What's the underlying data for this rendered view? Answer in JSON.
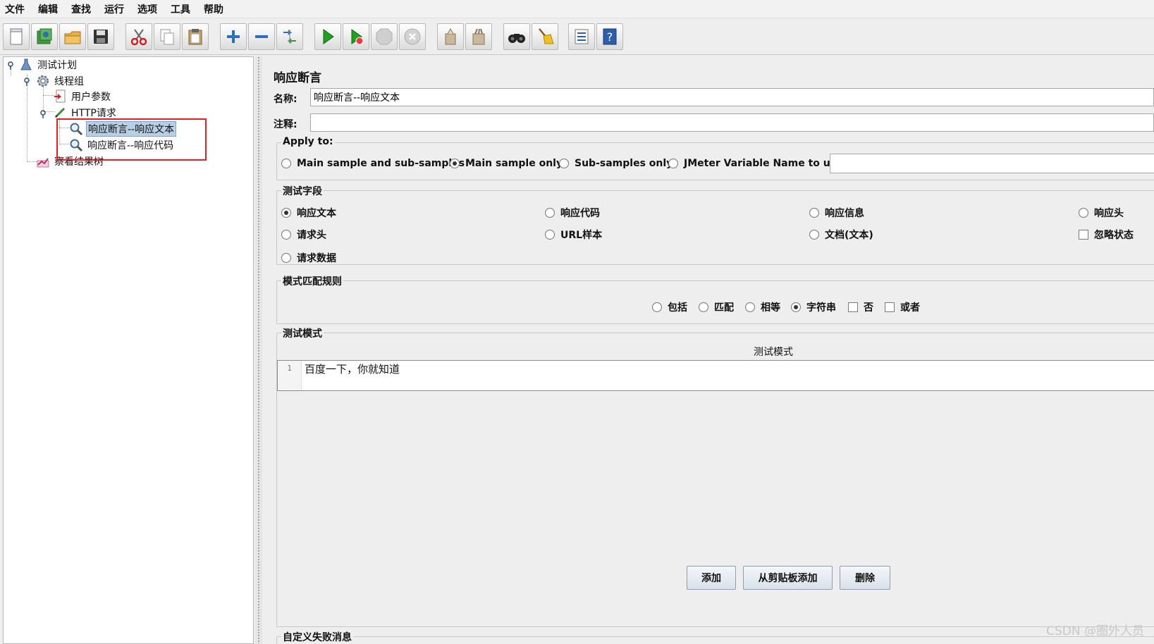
{
  "menu": [
    "文件",
    "编辑",
    "查找",
    "运行",
    "选项",
    "工具",
    "帮助"
  ],
  "toolbar_icons": [
    "new-icon",
    "templates-icon",
    "open-icon",
    "save-icon",
    "cut-icon",
    "copy-icon",
    "paste-icon",
    "expand-icon",
    "collapse-icon",
    "toggle-icon",
    "start-icon",
    "start-no-pause-icon",
    "stop-icon",
    "shutdown-icon",
    "clear-icon",
    "clear-all-icon",
    "search-icon",
    "reset-search-icon",
    "function-helper-icon",
    "help-icon"
  ],
  "tree": {
    "test_plan": "测试计划",
    "thread_group": "线程组",
    "user_params": "用户参数",
    "http_request": "HTTP请求",
    "assertion_text": "响应断言--响应文本",
    "assertion_code": "响应断言--响应代码",
    "result_tree": "察看结果树"
  },
  "panel": {
    "title": "响应断言",
    "name_label": "名称:",
    "name_value": "响应断言--响应文本",
    "comment_label": "注释:",
    "comment_value": ""
  },
  "apply_to": {
    "title": "Apply to:",
    "options": [
      "Main sample and sub-samples",
      "Main sample only",
      "Sub-samples only",
      "JMeter Variable Name to use"
    ],
    "selected": "Main sample only",
    "variable_value": ""
  },
  "test_field": {
    "title": "测试字段",
    "options": [
      "响应文本",
      "响应代码",
      "响应信息",
      "响应头",
      "请求头",
      "URL样本",
      "文档(文本)",
      "忽略状态",
      "请求数据"
    ],
    "selected": "响应文本"
  },
  "pattern_rules": {
    "title": "模式匹配规则",
    "options": [
      "包括",
      "匹配",
      "相等",
      "字符串",
      "否",
      "或者"
    ],
    "selected": "字符串"
  },
  "patterns": {
    "title": "测试模式",
    "column_header": "测试模式",
    "rows": [
      {
        "line": "1",
        "text": "百度一下，你就知道"
      }
    ],
    "buttons": [
      "添加",
      "从剪贴板添加",
      "删除"
    ]
  },
  "failure_message": {
    "title": "自定义失败消息"
  },
  "watermark": "CSDN @圈外人员",
  "colors": {
    "selection": "#b8cfe5",
    "highlight_border": "#d9232c"
  }
}
